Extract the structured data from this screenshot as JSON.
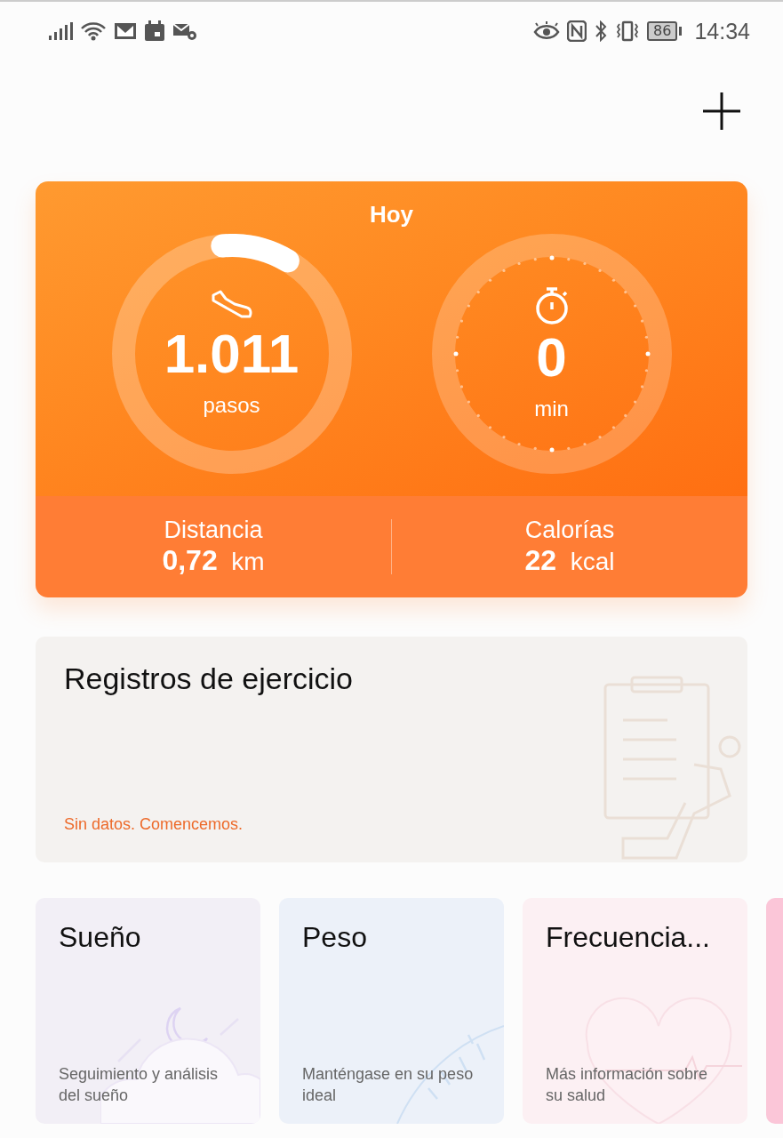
{
  "status_bar": {
    "battery": "86",
    "time": "14:34"
  },
  "today": {
    "title": "Hoy",
    "steps": {
      "value": "1.011",
      "unit": "pasos",
      "level": 0.1
    },
    "active": {
      "value": "0",
      "unit": "min"
    },
    "stats": [
      {
        "label": "Distancia",
        "value": "0,72",
        "unit": "km"
      },
      {
        "label": "Calorías",
        "value": "22",
        "unit": "kcal"
      }
    ]
  },
  "exercise": {
    "title": "Registros de ejercicio",
    "message": "Sin datos. Comencemos."
  },
  "cards": [
    {
      "kind": "sleep",
      "title": "Sueño",
      "description": "Seguimiento y análisis del sueño"
    },
    {
      "kind": "weight",
      "title": "Peso",
      "description": "Manténgase en su peso ideal"
    },
    {
      "kind": "heart",
      "title": "Frecuencia...",
      "description": "Más información sobre su salud"
    },
    {
      "kind": "partial"
    }
  ]
}
